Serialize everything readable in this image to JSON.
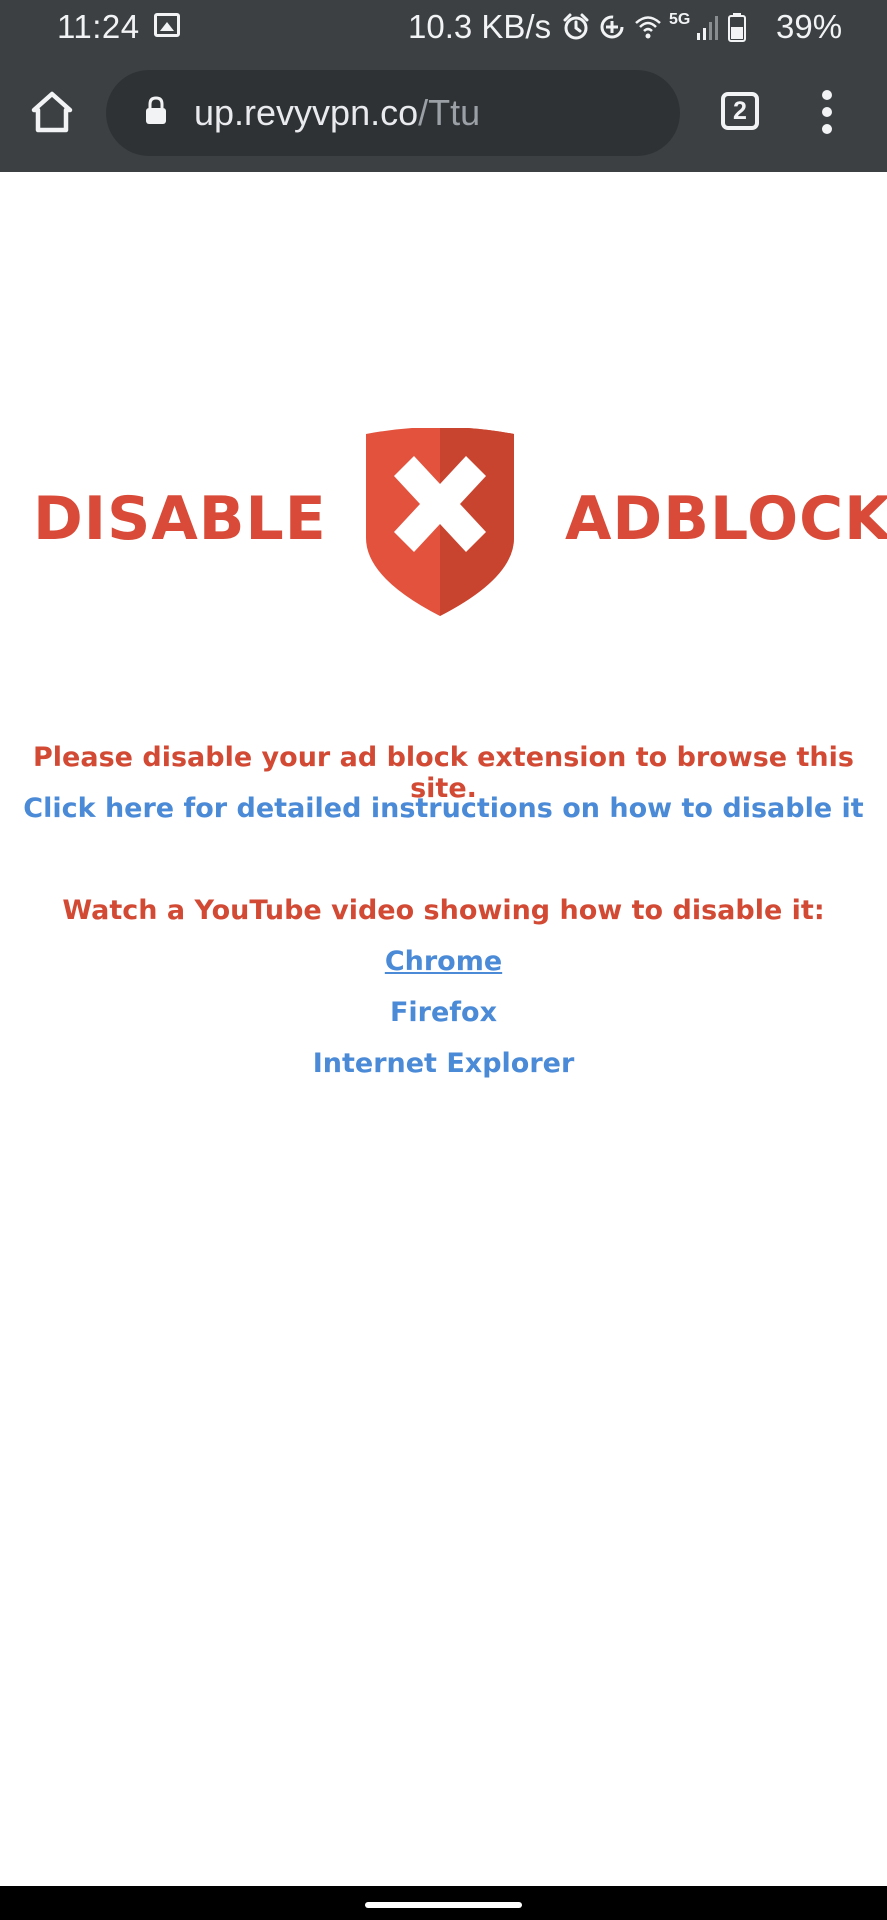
{
  "status_bar": {
    "time": "11:24",
    "network_speed": "10.3 KB/s",
    "network_type": "5G",
    "battery": "39%"
  },
  "browser": {
    "url_domain": "up.revyvpn.co",
    "url_path": "/Ttu",
    "tab_count": "2"
  },
  "banner": {
    "left_word": "DISABLE",
    "right_word": "ADBLOCK",
    "shield_color": "#e2523d",
    "shield_shadow_color": "#c9442f"
  },
  "content": {
    "notice": "Please disable your ad block extension to browse this site.",
    "instructions_link": "Click here for detailed instructions on how to disable it",
    "video_heading": "Watch a YouTube video showing how to disable it:",
    "links": [
      "Chrome",
      "Firefox",
      "Internet Explorer"
    ]
  },
  "colors": {
    "accent_red": "#d24a34",
    "link_blue": "#4a8ad6",
    "toolbar": "#3c4043"
  },
  "icons": {
    "home": "home-icon",
    "lock": "lock-icon",
    "menu": "more-vert-icon"
  }
}
